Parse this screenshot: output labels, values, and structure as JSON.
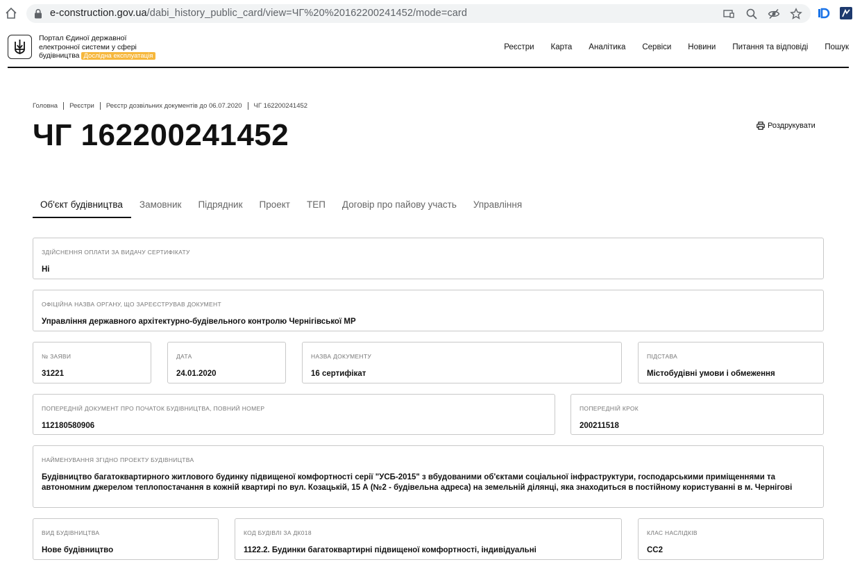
{
  "browser": {
    "url_host": "e-construction.gov.ua",
    "url_path": "/dabi_history_public_card/view=ЧГ%20%20162200241452/mode=card"
  },
  "header": {
    "portal_line1": "Портал Єдиної державної",
    "portal_line2": "електронної системи у сфері",
    "portal_line3": "будівництва",
    "badge": "Дослідна експлуатація",
    "nav": [
      "Реєстри",
      "Карта",
      "Аналітика",
      "Сервіси",
      "Новини",
      "Питання та відповіді",
      "Пошук"
    ]
  },
  "breadcrumb": [
    "Головна",
    "Реєстри",
    "Реєстр дозвільних документів до 06.07.2020",
    "ЧГ 162200241452"
  ],
  "page_title": "ЧГ 162200241452",
  "print_label": "Роздрукувати",
  "tabs": [
    "Об'єкт будівництва",
    "Замовник",
    "Підрядник",
    "Проект",
    "ТЕП",
    "Договір про пайову участь",
    "Управління"
  ],
  "fields": {
    "payment": {
      "label": "Здійснення оплати за видачу сертифікату",
      "value": "Ні"
    },
    "authority": {
      "label": "Офіційна назва органу, що зареєстрував документ",
      "value": "Управління державного архітектурно-будівельного контролю Чернігівської МР"
    },
    "app_no": {
      "label": "№ заяви",
      "value": "31221"
    },
    "date": {
      "label": "Дата",
      "value": "24.01.2020"
    },
    "doc_name": {
      "label": "Назва документу",
      "value": "16 сертифікат"
    },
    "basis": {
      "label": "Підстава",
      "value": "Містобудівні умови і обмеження"
    },
    "prev_doc": {
      "label": "Попередній документ про початок будівництва, повний номер",
      "value": "112180580906"
    },
    "prev_step": {
      "label": "Попередній крок",
      "value": "200211518"
    },
    "project_name": {
      "label": "Найменування згідно проекту будівництва",
      "value": "Будівництво багатоквартирного житлового будинку підвищеної комфортності серії \"УСБ-2015\" з вбудованими об'єктами соціальної інфраструктури, господарськими приміщеннями та автономним джерелом теплопостачання в кожній квартирі по вул. Козацькій, 15 А (№2 - будівельна адреса) на земельній ділянці, яка знаходиться в постійному користуванні в м. Чернігові"
    },
    "build_type": {
      "label": "Вид будівництва",
      "value": "Нове будівництво"
    },
    "dk018": {
      "label": "Код будівлі за ДК018",
      "value": "1122.2. Будинки багатоквартирні підвищеної комфортності, індивідуальні"
    },
    "cc_class": {
      "label": "Клас наслідків",
      "value": "СС2"
    }
  }
}
